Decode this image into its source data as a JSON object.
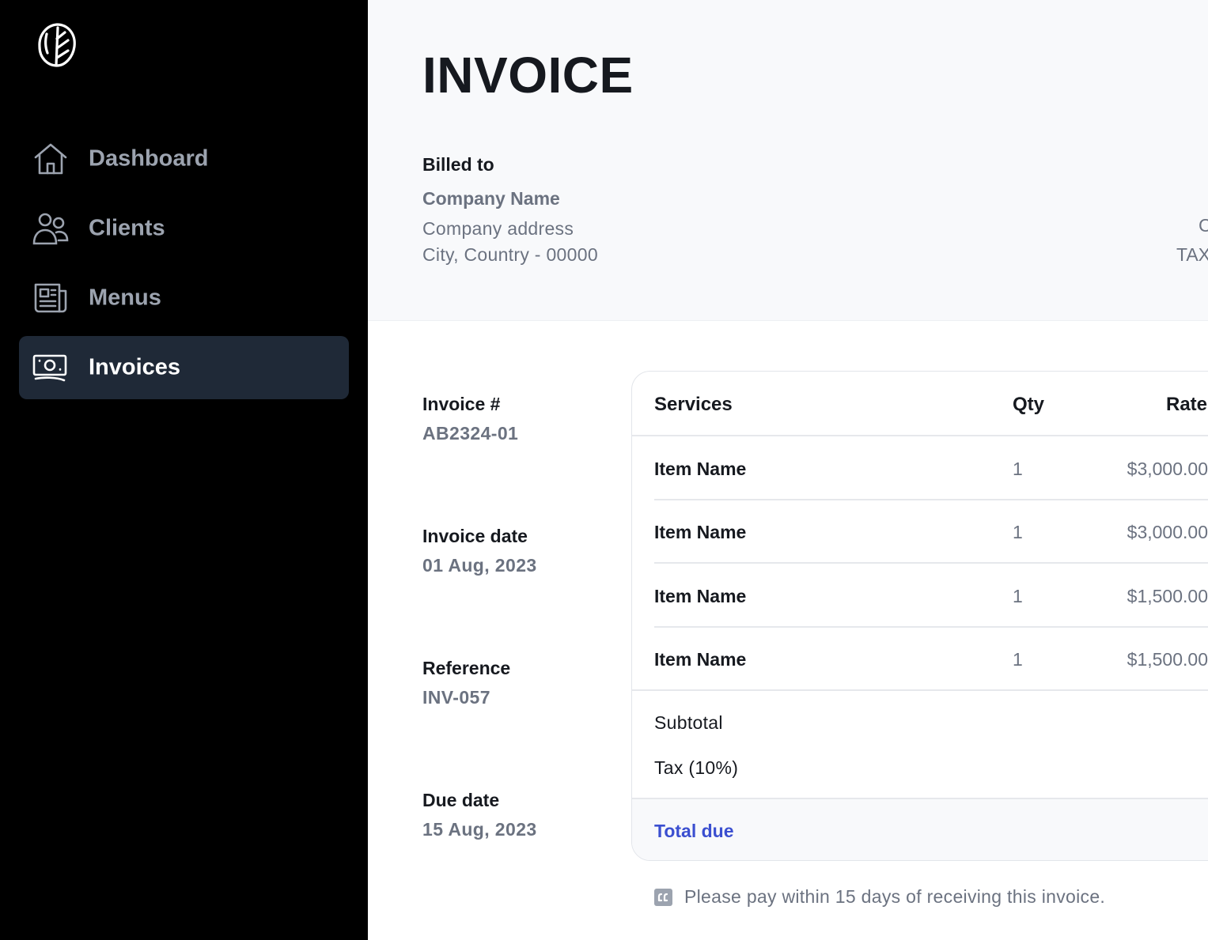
{
  "sidebar": {
    "logo_icon": "leaf-logo-icon",
    "items": [
      {
        "label": "Dashboard",
        "icon": "home-icon"
      },
      {
        "label": "Clients",
        "icon": "users-icon"
      },
      {
        "label": "Menus",
        "icon": "newspaper-icon"
      },
      {
        "label": "Invoices",
        "icon": "cash-icon",
        "active": true
      }
    ]
  },
  "header": {
    "title": "INVOICE",
    "billed_to_label": "Billed to",
    "company_name": "Company Name",
    "company_address": "Company address",
    "company_city": "City, Country - 00000",
    "right_clipped_1": "C",
    "right_clipped_2": "TAX"
  },
  "meta": {
    "invoice_number_label": "Invoice #",
    "invoice_number": "AB2324-01",
    "invoice_date_label": "Invoice date",
    "invoice_date": "01 Aug, 2023",
    "reference_label": "Reference",
    "reference": "INV-057",
    "due_date_label": "Due date",
    "due_date": "15 Aug, 2023"
  },
  "table": {
    "columns": {
      "services": "Services",
      "qty": "Qty",
      "rate": "Rate"
    },
    "rows": [
      {
        "name": "Item Name",
        "qty": "1",
        "rate": "$3,000.00"
      },
      {
        "name": "Item Name",
        "qty": "1",
        "rate": "$3,000.00"
      },
      {
        "name": "Item Name",
        "qty": "1",
        "rate": "$1,500.00"
      },
      {
        "name": "Item Name",
        "qty": "1",
        "rate": "$1,500.00"
      }
    ],
    "subtotal_label": "Subtotal",
    "tax_label": "Tax (10%)",
    "total_label": "Total due"
  },
  "note": {
    "icon": "quote-icon",
    "text": "Please pay within 15 days of receiving this invoice."
  },
  "colors": {
    "sidebar_bg": "#000000",
    "active_item_bg": "#1f2937",
    "accent": "#3b4fd0"
  }
}
